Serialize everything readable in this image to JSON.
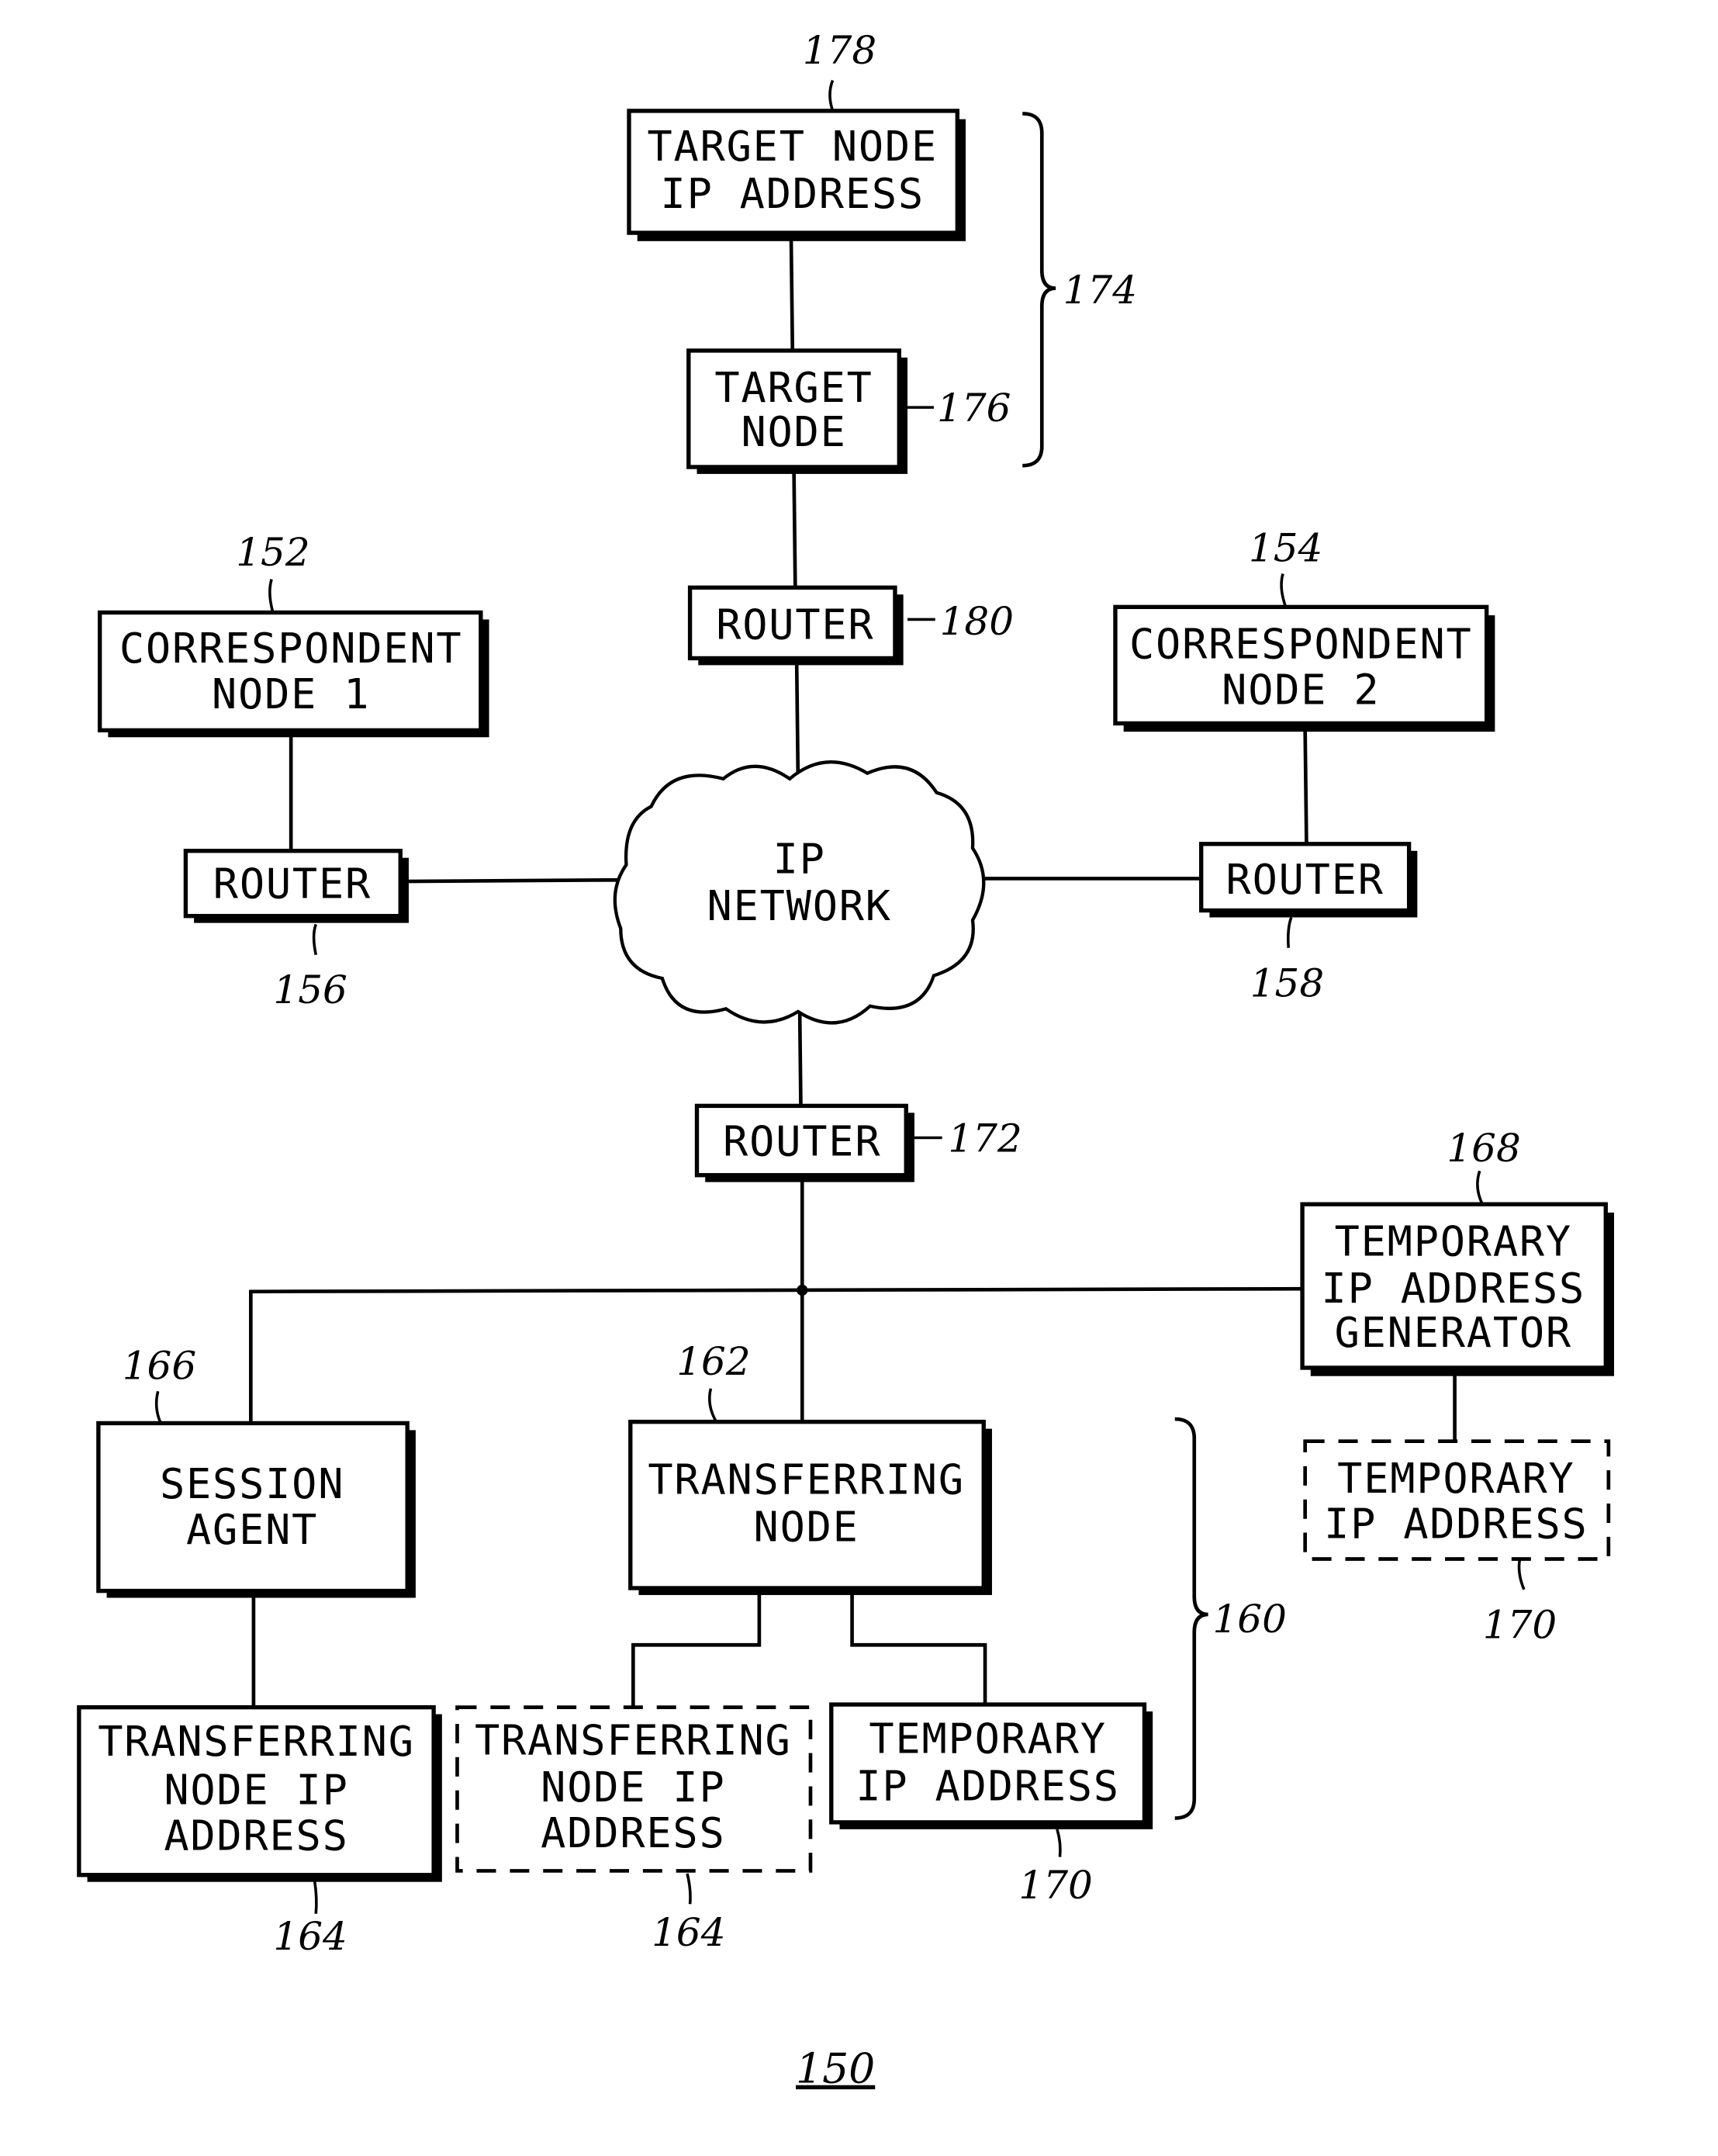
{
  "figure_label": "150",
  "nodes": {
    "target_ip": {
      "lines": [
        "TARGET NODE",
        "IP ADDRESS"
      ],
      "ref": "178"
    },
    "target_node": {
      "lines": [
        "TARGET",
        "NODE"
      ],
      "ref": "176"
    },
    "router_top": {
      "lines": [
        "ROUTER"
      ],
      "ref": "180"
    },
    "cn1": {
      "lines": [
        "CORRESPONDENT",
        "NODE 1"
      ],
      "ref": "152"
    },
    "cn2": {
      "lines": [
        "CORRESPONDENT",
        "NODE 2"
      ],
      "ref": "154"
    },
    "router_left": {
      "lines": [
        "ROUTER"
      ],
      "ref": "156"
    },
    "router_right": {
      "lines": [
        "ROUTER"
      ],
      "ref": "158"
    },
    "ip_network": {
      "lines": [
        "IP",
        "NETWORK"
      ]
    },
    "router_bottom": {
      "lines": [
        "ROUTER"
      ],
      "ref": "172"
    },
    "temp_gen": {
      "lines": [
        "TEMPORARY",
        "IP ADDRESS",
        "GENERATOR"
      ],
      "ref": "168"
    },
    "temp_ip_dashed": {
      "lines": [
        "TEMPORARY",
        "IP ADDRESS"
      ],
      "ref": "170"
    },
    "session_agent": {
      "lines": [
        "SESSION",
        "AGENT"
      ],
      "ref": "166"
    },
    "transferring_node": {
      "lines": [
        "TRANSFERRING",
        "NODE"
      ],
      "ref": "162"
    },
    "tn_ip_left": {
      "lines": [
        "TRANSFERRING",
        "NODE IP",
        "ADDRESS"
      ],
      "ref": "164"
    },
    "tn_ip_dashed": {
      "lines": [
        "TRANSFERRING",
        "NODE IP",
        "ADDRESS"
      ],
      "ref": "164"
    },
    "temp_ip_solid": {
      "lines": [
        "TEMPORARY",
        "IP ADDRESS"
      ],
      "ref": "170"
    }
  },
  "brackets": {
    "target_group": "174",
    "transferring_group": "160"
  }
}
